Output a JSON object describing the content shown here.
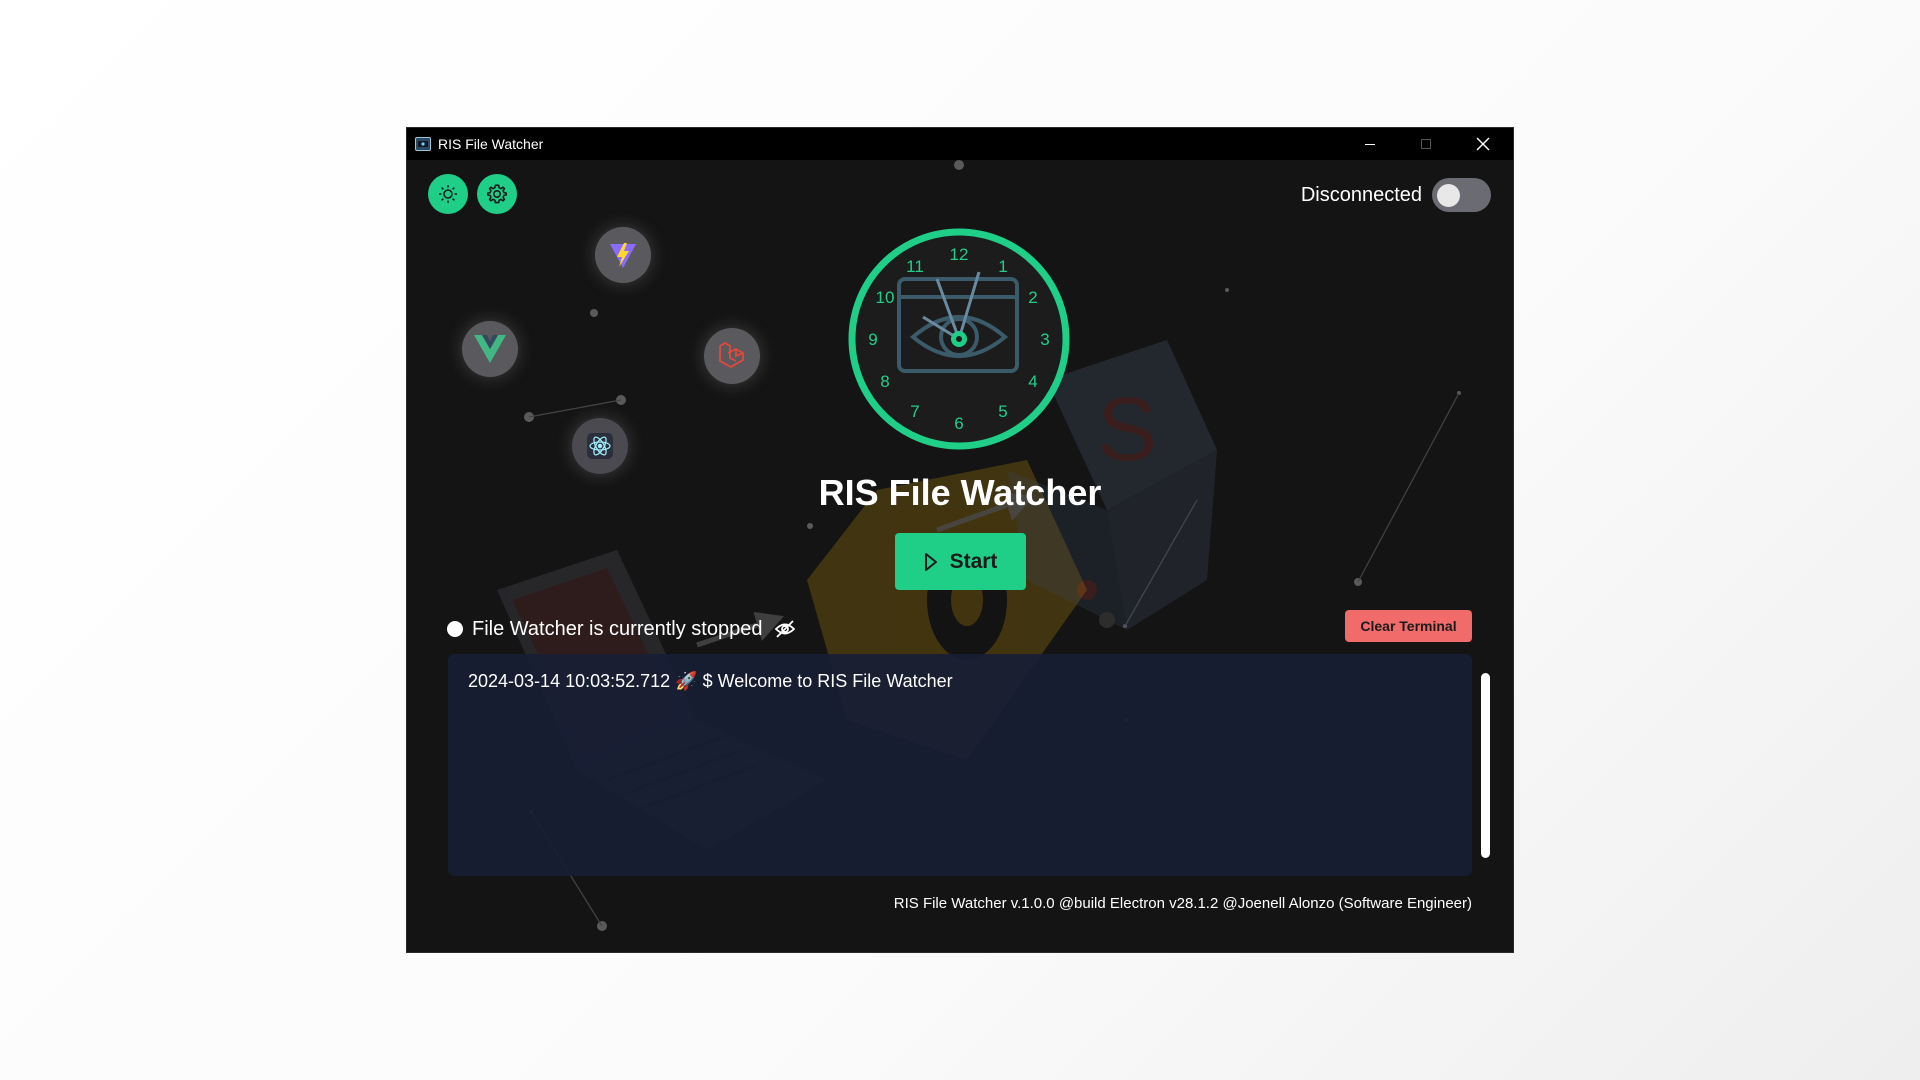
{
  "window": {
    "title": "RIS File Watcher"
  },
  "header": {
    "connection_status": "Disconnected",
    "toggle_on": false
  },
  "tech_icons": [
    "vite-icon",
    "vue-icon",
    "laravel-icon",
    "electron-icon"
  ],
  "clock": {
    "numbers": [
      "12",
      "1",
      "2",
      "3",
      "4",
      "5",
      "6",
      "7",
      "8",
      "9",
      "10",
      "11"
    ]
  },
  "main": {
    "app_title": "RIS File Watcher",
    "start_label": "Start"
  },
  "status": {
    "text": "File Watcher is currently stopped"
  },
  "terminal": {
    "clear_label": "Clear Terminal",
    "lines": [
      "2024-03-14 10:03:52.712 🚀 $ Welcome to RIS File Watcher"
    ]
  },
  "footer": {
    "text": "RIS File Watcher v.1.0.0 @build Electron v28.1.2 @Joenell Alonzo (Software Engineer)"
  },
  "colors": {
    "accent": "#1fcf88",
    "danger": "#f26b6b",
    "background": "#141414",
    "terminal_bg": "#181e34"
  }
}
